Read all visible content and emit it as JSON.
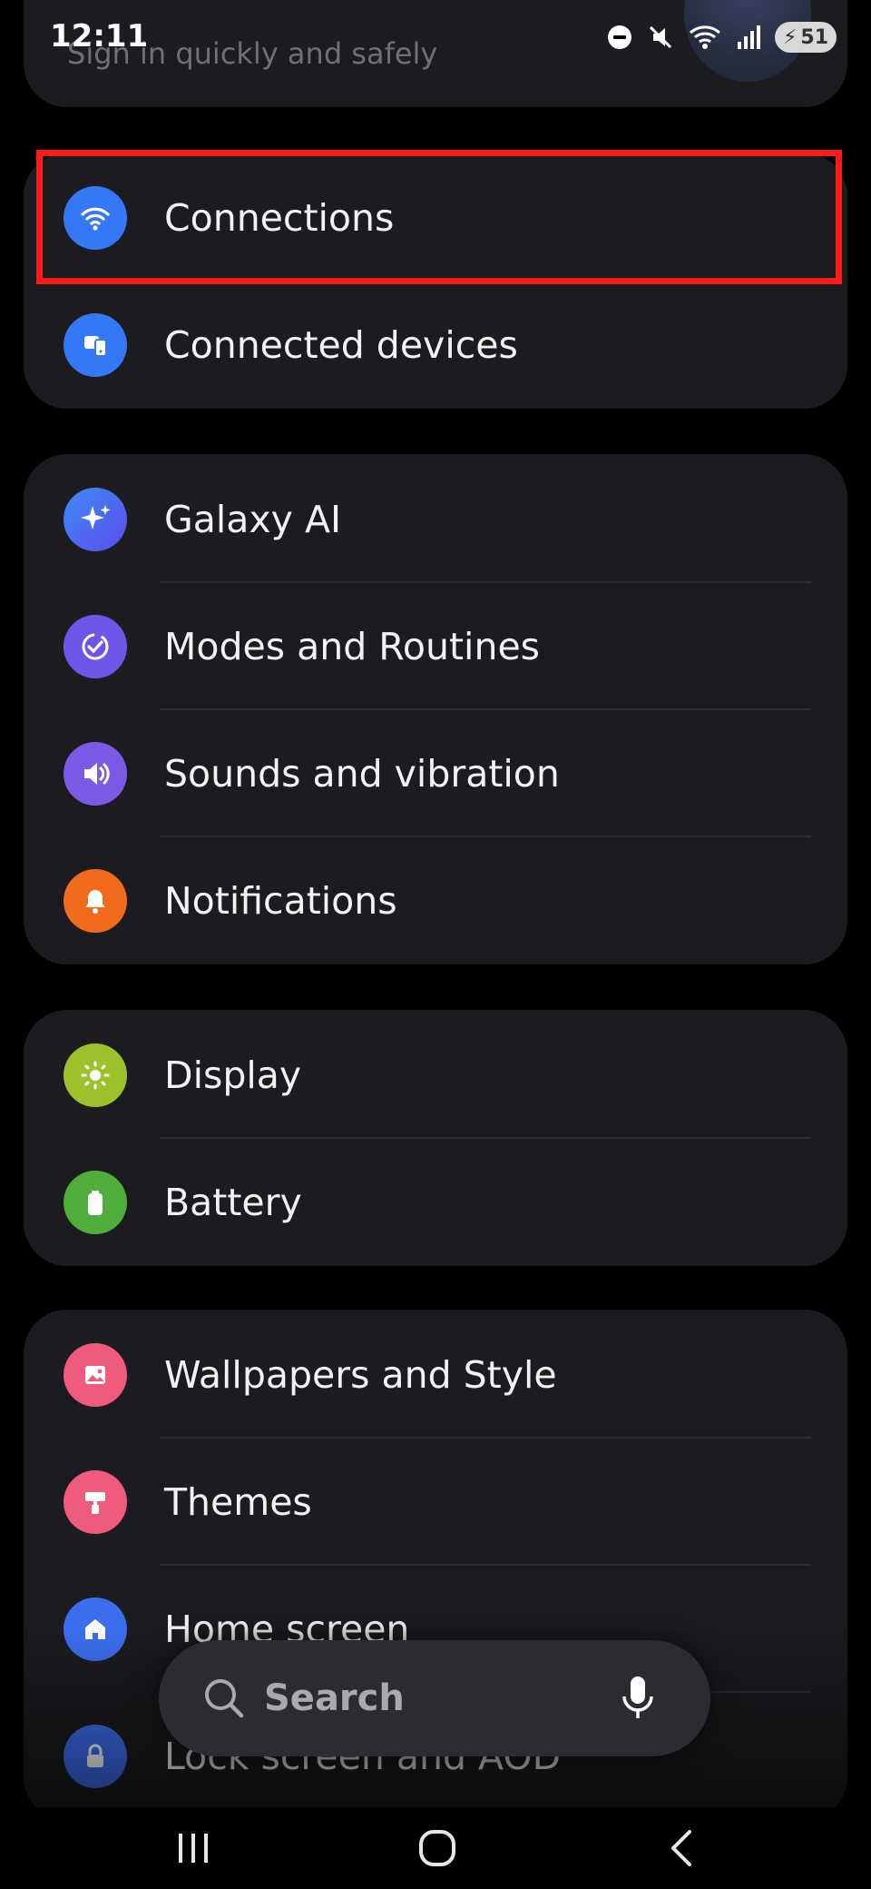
{
  "status_bar": {
    "time": "12:11",
    "battery_level": "51"
  },
  "account": {
    "subtitle": "Sign in quickly and safely"
  },
  "groups": [
    {
      "items": [
        {
          "label": "Connections",
          "icon": "wifi-icon",
          "color": "#3478f6"
        },
        {
          "label": "Connected devices",
          "icon": "connected-devices-icon",
          "color": "#3478f6"
        }
      ]
    },
    {
      "items": [
        {
          "label": "Galaxy AI",
          "icon": "sparkle-icon",
          "color": "#3b6df2"
        },
        {
          "label": "Modes and Routines",
          "icon": "modes-check-icon",
          "color": "#6e56e8"
        },
        {
          "label": "Sounds and vibration",
          "icon": "speaker-icon",
          "color": "#7b5be6"
        },
        {
          "label": "Notifications",
          "icon": "bell-icon",
          "color": "#f26a1b"
        }
      ]
    },
    {
      "items": [
        {
          "label": "Display",
          "icon": "brightness-icon",
          "color": "#9dc12a"
        },
        {
          "label": "Battery",
          "icon": "battery-icon",
          "color": "#4fae3b"
        }
      ]
    },
    {
      "items": [
        {
          "label": "Wallpapers and Style",
          "icon": "image-icon",
          "color": "#ef5b7d"
        },
        {
          "label": "Themes",
          "icon": "paint-roller-icon",
          "color": "#ef5b7d"
        },
        {
          "label": "Home screen",
          "icon": "home-icon",
          "color": "#3c6ef0"
        },
        {
          "label": "Lock screen and AOD",
          "icon": "lock-icon",
          "color": "#3c6ef0"
        }
      ]
    }
  ],
  "search": {
    "placeholder": "Search"
  },
  "highlight_color": "#ff1a1a"
}
